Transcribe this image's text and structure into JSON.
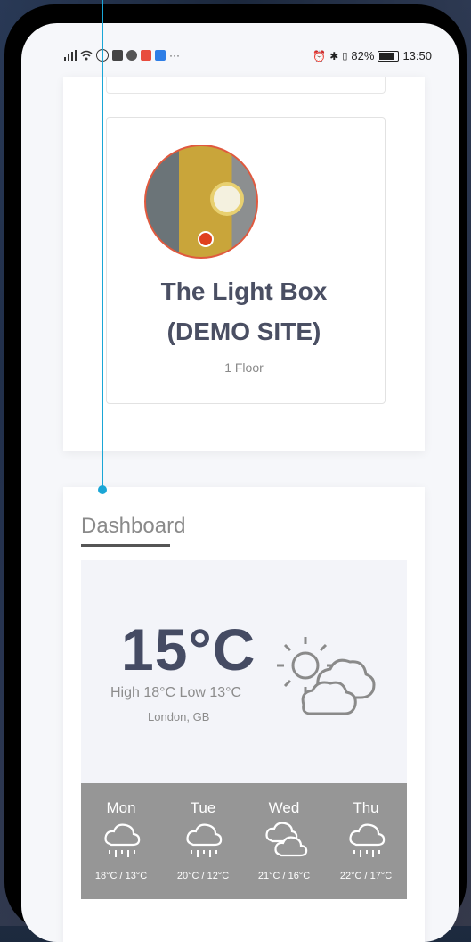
{
  "status_bar": {
    "battery_percent": "82%",
    "time": "13:50",
    "overflow": "···"
  },
  "site": {
    "name": "The Light Box (DEMO SITE)",
    "floors": "1 Floor"
  },
  "dashboard": {
    "title": "Dashboard",
    "weather": {
      "temperature": "15°C",
      "high_low": "High 18°C Low 13°C",
      "location": "London, GB",
      "current_icon": "partly-cloudy-icon",
      "forecast": [
        {
          "day": "Mon",
          "temps": "18°C / 13°C",
          "icon": "rain-icon"
        },
        {
          "day": "Tue",
          "temps": "20°C / 12°C",
          "icon": "rain-icon"
        },
        {
          "day": "Wed",
          "temps": "21°C / 16°C",
          "icon": "cloudy-icon"
        },
        {
          "day": "Thu",
          "temps": "22°C / 17°C",
          "icon": "rain-icon"
        }
      ]
    }
  },
  "colors": {
    "accent_pointer": "#1aa6d6",
    "title_text": "#4a4f63",
    "forecast_bg": "#969696",
    "avatar_border": "#e0593e"
  }
}
